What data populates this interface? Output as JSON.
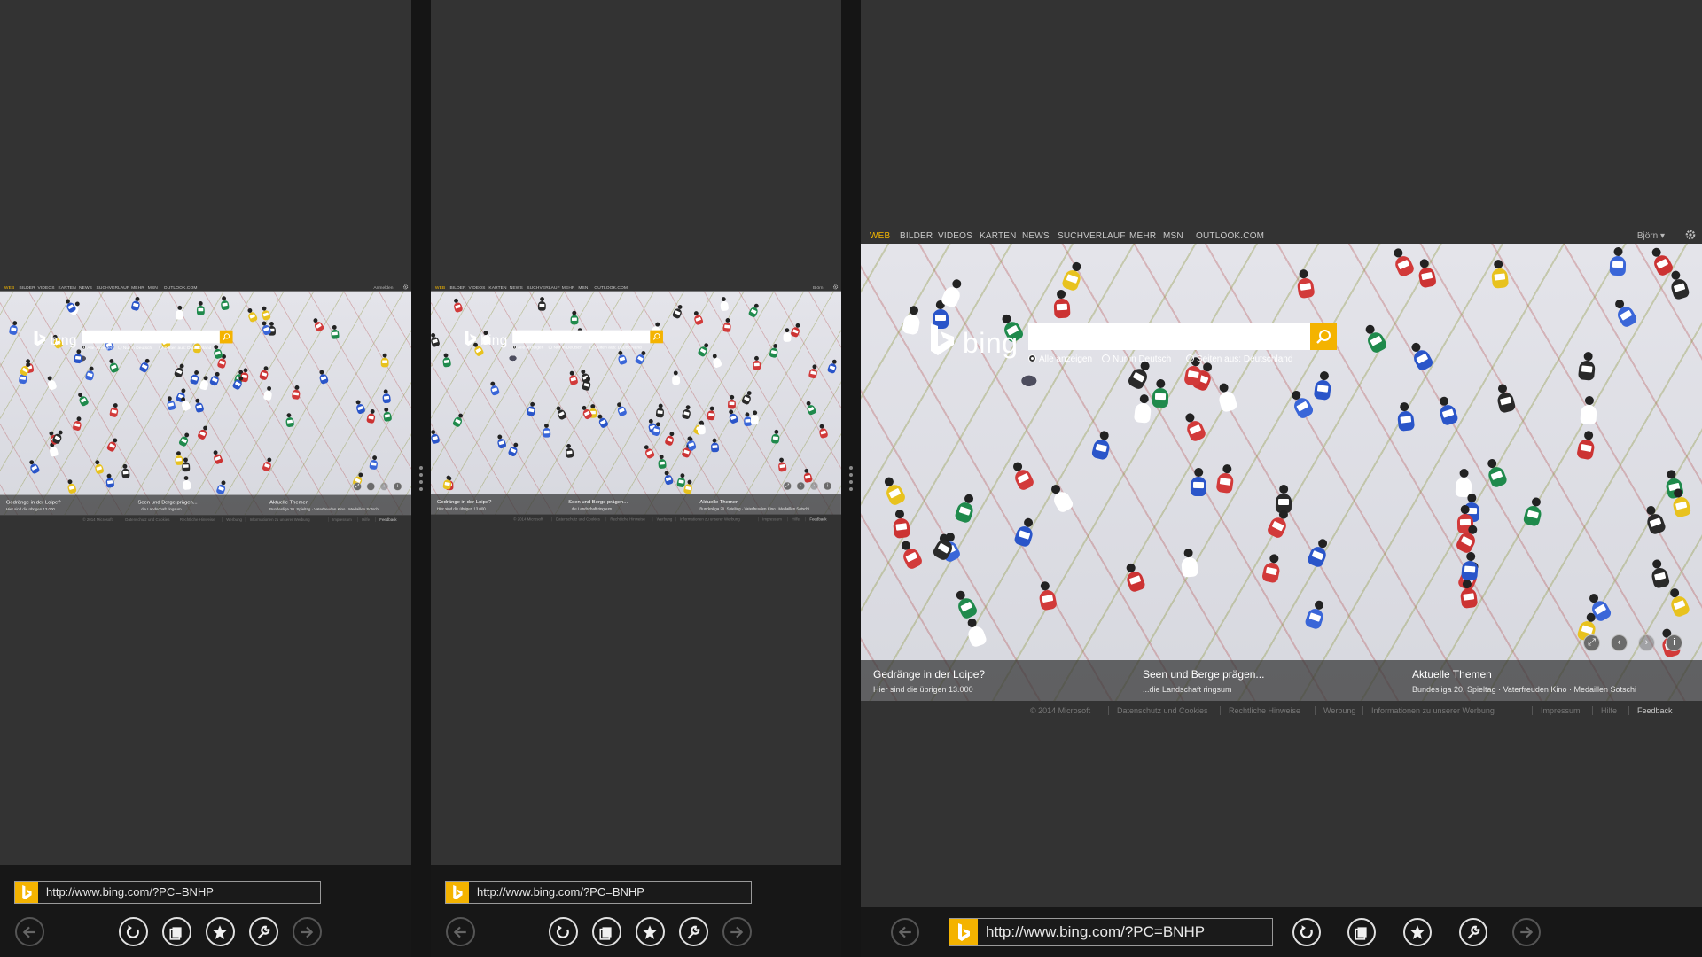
{
  "nav": {
    "items": [
      "WEB",
      "BILDER",
      "VIDEOS",
      "KARTEN",
      "NEWS",
      "SUCHVERLAUF",
      "MEHR",
      "MSN",
      "OUTLOOK.COM"
    ],
    "user_pane1": "Anmelden",
    "user_pane2": "Björn",
    "user_pane3": "Björn ▾"
  },
  "logo_text": "bing",
  "search": {
    "value": "",
    "radios": [
      "Alle anzeigen",
      "Nur in Deutsch",
      "Seiten aus: Deutschland"
    ]
  },
  "hero_controls": [
    "⤢",
    "‹",
    "›",
    "i"
  ],
  "strip": [
    {
      "title": "Gedränge in der Loipe?",
      "sub": "Hier sind die übrigen 13.000"
    },
    {
      "title": "Seen und Berge prägen...",
      "sub": "...die Landschaft ringsum"
    },
    {
      "title": "Aktuelle Themen",
      "sub": "Bundesliga 20. Spieltag · Vaterfreuden Kino · Medaillen Sotschi"
    }
  ],
  "footer": [
    "© 2014 Microsoft",
    "Datenschutz und Cookies",
    "Rechtliche Hinweise",
    "Werbung",
    "Informationen zu unserer Werbung",
    "Impressum",
    "Hilfe",
    "Feedback"
  ],
  "appbar": {
    "url": "http://www.bing.com/?PC=BNHP",
    "buttons": [
      "back-button",
      "refresh-button",
      "tabs-button",
      "favorites-button",
      "tools-button",
      "forward-button"
    ]
  },
  "colors": {
    "accent": "#f4b300",
    "nav_active": "#f5b800",
    "background": "#333333"
  }
}
